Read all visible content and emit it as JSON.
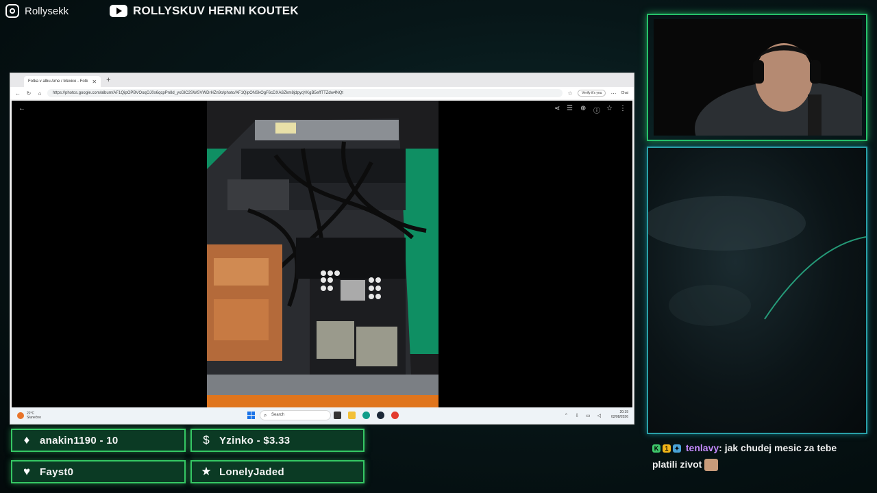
{
  "socials": {
    "instagram_handle": "Rollysekk",
    "youtube_channel": "ROLLYSKUV HERNI KOUTEK"
  },
  "browser": {
    "tab_title": "Fotka v albu Ame / Mexico - Fotk",
    "url": "https://photos.google.com/album/AF1QipOPBVOoqOJ0s6qcpPn8d_yxGlC2SWSVWDrHZn9o/photo/AF1QipONSkOgF6cDXA8Zkm8jdpyqYKgB5effTTZdw4NQt",
    "verify_label": "Verify it's you",
    "chat_label": "Chat"
  },
  "taskbar": {
    "weather_temp": "22°C",
    "weather_desc": "Slunečno",
    "search_placeholder": "Search",
    "time": "20:19",
    "date": "02/08/2026"
  },
  "alerts": [
    {
      "icon": "diamond-icon",
      "text": "anakin1190 - 10"
    },
    {
      "icon": "dollar-icon",
      "text": "Yzinko - $3.33"
    },
    {
      "icon": "heart-icon",
      "text": "Fayst0"
    },
    {
      "icon": "star-icon",
      "text": "LonelyJaded"
    }
  ],
  "chat": {
    "user": "tenlavy",
    "message": ": jak chudej mesic za tebe platili zivot"
  },
  "colors": {
    "alert_border": "#35c864",
    "cam_border": "#27c26a",
    "panel_border": "#2aa0a8",
    "chat_user": "#c68bff"
  }
}
